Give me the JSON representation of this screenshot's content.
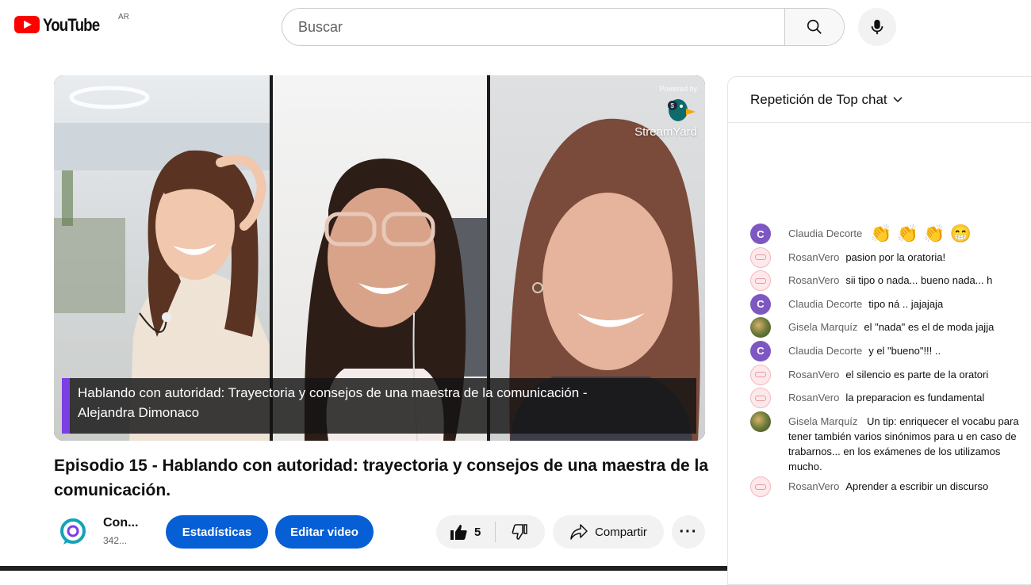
{
  "header": {
    "logo_text": "YouTube",
    "country_code": "AR",
    "search_placeholder": "Buscar"
  },
  "video": {
    "streamyard_powered": "Powered by",
    "streamyard_brand": "StreamYard",
    "caption_line1": "Hablando con autoridad: Trayectoria y consejos de una maestra de la comunicación -",
    "caption_line2": "Alejandra Dimonaco",
    "caption_accent": "#7b3fe4"
  },
  "title": "Episodio 15 - Hablando con autoridad: trayectoria y consejos de una maestra de la comunicación.",
  "channel": {
    "name": "Con...",
    "subs": "342..."
  },
  "actions": {
    "stats_label": "Estadísticas",
    "edit_label": "Editar video",
    "like_count": "5",
    "share_label": "Compartir"
  },
  "chat": {
    "header": "Repetición de Top chat",
    "messages": [
      {
        "author": "Claudia Decorte",
        "text": "",
        "emojis": [
          "👏",
          "👏",
          "👏",
          "😁"
        ],
        "avatar": "C"
      },
      {
        "author": "RosanVero",
        "text": "pasion por la oratoria!",
        "avatar": ""
      },
      {
        "author": "RosanVero",
        "text": "sii tipo o nada... bueno nada... h",
        "avatar": ""
      },
      {
        "author": "Claudia Decorte",
        "text": "tipo ná .. jajajaja",
        "avatar": "C"
      },
      {
        "author": "Gisela Marquíz",
        "text": "el \"nada\" es el de moda jajja",
        "avatar": ""
      },
      {
        "author": "Claudia Decorte",
        "text": "y el \"bueno\"!!! ..",
        "avatar": "C"
      },
      {
        "author": "RosanVero",
        "text": "el silencio es parte de la oratori",
        "avatar": ""
      },
      {
        "author": "RosanVero",
        "text": "la preparacion es fundamental",
        "avatar": ""
      },
      {
        "author": "Gisela Marquíz",
        "text": "Un tip: enriquecer el vocabu para tener también varios sinónimos para u en caso de trabarnos... en los exámenes de los utilizamos mucho.",
        "avatar": ""
      },
      {
        "author": "RosanVero",
        "text": "Aprender a escribir un discurso",
        "avatar": ""
      }
    ]
  }
}
